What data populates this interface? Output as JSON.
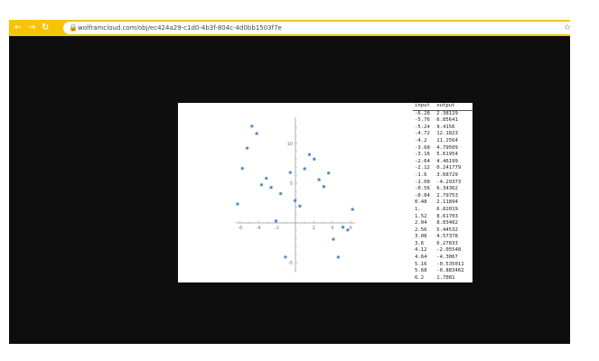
{
  "browser": {
    "back_icon": "arrow-left-icon",
    "forward_icon": "arrow-right-icon",
    "reload_icon": "reload-icon",
    "lock_icon": "lock-icon",
    "bookmark_icon": "star-icon",
    "url": "wolframcloud.com/obj/ec424a29-c1d0-4b3f-804c-4d0bb1503f7e",
    "accent": "#f7c403"
  },
  "table": {
    "headers": [
      "input",
      "output"
    ],
    "rows": [
      [
        "-6.28",
        "2.38129"
      ],
      [
        "-5.76",
        "6.85641"
      ],
      [
        "-5.24",
        "9.4156"
      ],
      [
        "-4.72",
        "12.1823"
      ],
      [
        "-4.2",
        "11.2564"
      ],
      [
        "-3.68",
        "4.79509"
      ],
      [
        "-3.16",
        "5.61954"
      ],
      [
        "-2.64",
        "4.46199"
      ],
      [
        "-2.12",
        "0.241779"
      ],
      [
        "-1.6",
        "3.68729"
      ],
      [
        "-1.08",
        "-4.29373"
      ],
      [
        "-0.56",
        "6.34362"
      ],
      [
        "-0.04",
        "2.79753"
      ],
      [
        "0.48",
        "2.11894"
      ],
      [
        "1.",
        "6.82019"
      ],
      [
        "1.52",
        "8.61703"
      ],
      [
        "2.04",
        "8.03402"
      ],
      [
        "2.56",
        "5.44532"
      ],
      [
        "3.08",
        "4.57378"
      ],
      [
        "3.6",
        "6.27833"
      ],
      [
        "4.12",
        "-2.05548"
      ],
      [
        "4.64",
        "-4.3067"
      ],
      [
        "5.16",
        "-0.535011"
      ],
      [
        "5.68",
        "-0.883462"
      ],
      [
        "6.2",
        "1.7081"
      ]
    ]
  },
  "chart_data": {
    "type": "scatter",
    "x": [
      -6.28,
      -5.76,
      -5.24,
      -4.72,
      -4.2,
      -3.68,
      -3.16,
      -2.64,
      -2.12,
      -1.6,
      -1.08,
      -0.56,
      -0.04,
      0.48,
      1.0,
      1.52,
      2.04,
      2.56,
      3.08,
      3.6,
      4.12,
      4.64,
      5.16,
      5.68,
      6.2
    ],
    "y": [
      2.38129,
      6.85641,
      9.4156,
      12.1823,
      11.2564,
      4.79509,
      5.61954,
      4.46199,
      0.241779,
      3.68729,
      -4.29373,
      6.34362,
      2.79753,
      2.11894,
      6.82019,
      8.61703,
      8.03402,
      5.44532,
      4.57378,
      6.27833,
      -2.05548,
      -4.3067,
      -0.535011,
      -0.883462,
      1.7081
    ],
    "x_ticks": [
      "-6",
      "-4",
      "-2",
      "2",
      "4",
      "6"
    ],
    "y_ticks": [
      "-5",
      "5",
      "10"
    ],
    "xlim": [
      -6.5,
      6.5
    ],
    "ylim": [
      -6.2,
      13.3
    ],
    "point_color": "#5b8fc9",
    "axis_color": "#999999"
  }
}
